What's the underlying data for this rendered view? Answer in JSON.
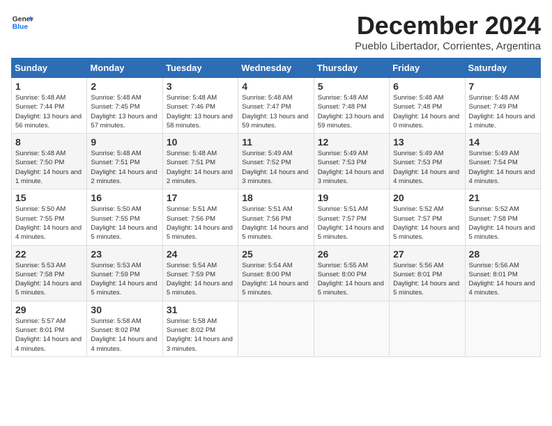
{
  "logo": {
    "line1": "General",
    "line2": "Blue"
  },
  "title": "December 2024",
  "subtitle": "Pueblo Libertador, Corrientes, Argentina",
  "days_of_week": [
    "Sunday",
    "Monday",
    "Tuesday",
    "Wednesday",
    "Thursday",
    "Friday",
    "Saturday"
  ],
  "weeks": [
    [
      {
        "day": "1",
        "sunrise": "Sunrise: 5:48 AM",
        "sunset": "Sunset: 7:44 PM",
        "daylight": "Daylight: 13 hours and 56 minutes."
      },
      {
        "day": "2",
        "sunrise": "Sunrise: 5:48 AM",
        "sunset": "Sunset: 7:45 PM",
        "daylight": "Daylight: 13 hours and 57 minutes."
      },
      {
        "day": "3",
        "sunrise": "Sunrise: 5:48 AM",
        "sunset": "Sunset: 7:46 PM",
        "daylight": "Daylight: 13 hours and 58 minutes."
      },
      {
        "day": "4",
        "sunrise": "Sunrise: 5:48 AM",
        "sunset": "Sunset: 7:47 PM",
        "daylight": "Daylight: 13 hours and 59 minutes."
      },
      {
        "day": "5",
        "sunrise": "Sunrise: 5:48 AM",
        "sunset": "Sunset: 7:48 PM",
        "daylight": "Daylight: 13 hours and 59 minutes."
      },
      {
        "day": "6",
        "sunrise": "Sunrise: 5:48 AM",
        "sunset": "Sunset: 7:48 PM",
        "daylight": "Daylight: 14 hours and 0 minutes."
      },
      {
        "day": "7",
        "sunrise": "Sunrise: 5:48 AM",
        "sunset": "Sunset: 7:49 PM",
        "daylight": "Daylight: 14 hours and 1 minute."
      }
    ],
    [
      {
        "day": "8",
        "sunrise": "Sunrise: 5:48 AM",
        "sunset": "Sunset: 7:50 PM",
        "daylight": "Daylight: 14 hours and 1 minute."
      },
      {
        "day": "9",
        "sunrise": "Sunrise: 5:48 AM",
        "sunset": "Sunset: 7:51 PM",
        "daylight": "Daylight: 14 hours and 2 minutes."
      },
      {
        "day": "10",
        "sunrise": "Sunrise: 5:48 AM",
        "sunset": "Sunset: 7:51 PM",
        "daylight": "Daylight: 14 hours and 2 minutes."
      },
      {
        "day": "11",
        "sunrise": "Sunrise: 5:49 AM",
        "sunset": "Sunset: 7:52 PM",
        "daylight": "Daylight: 14 hours and 3 minutes."
      },
      {
        "day": "12",
        "sunrise": "Sunrise: 5:49 AM",
        "sunset": "Sunset: 7:53 PM",
        "daylight": "Daylight: 14 hours and 3 minutes."
      },
      {
        "day": "13",
        "sunrise": "Sunrise: 5:49 AM",
        "sunset": "Sunset: 7:53 PM",
        "daylight": "Daylight: 14 hours and 4 minutes."
      },
      {
        "day": "14",
        "sunrise": "Sunrise: 5:49 AM",
        "sunset": "Sunset: 7:54 PM",
        "daylight": "Daylight: 14 hours and 4 minutes."
      }
    ],
    [
      {
        "day": "15",
        "sunrise": "Sunrise: 5:50 AM",
        "sunset": "Sunset: 7:55 PM",
        "daylight": "Daylight: 14 hours and 4 minutes."
      },
      {
        "day": "16",
        "sunrise": "Sunrise: 5:50 AM",
        "sunset": "Sunset: 7:55 PM",
        "daylight": "Daylight: 14 hours and 5 minutes."
      },
      {
        "day": "17",
        "sunrise": "Sunrise: 5:51 AM",
        "sunset": "Sunset: 7:56 PM",
        "daylight": "Daylight: 14 hours and 5 minutes."
      },
      {
        "day": "18",
        "sunrise": "Sunrise: 5:51 AM",
        "sunset": "Sunset: 7:56 PM",
        "daylight": "Daylight: 14 hours and 5 minutes."
      },
      {
        "day": "19",
        "sunrise": "Sunrise: 5:51 AM",
        "sunset": "Sunset: 7:57 PM",
        "daylight": "Daylight: 14 hours and 5 minutes."
      },
      {
        "day": "20",
        "sunrise": "Sunrise: 5:52 AM",
        "sunset": "Sunset: 7:57 PM",
        "daylight": "Daylight: 14 hours and 5 minutes."
      },
      {
        "day": "21",
        "sunrise": "Sunrise: 5:52 AM",
        "sunset": "Sunset: 7:58 PM",
        "daylight": "Daylight: 14 hours and 5 minutes."
      }
    ],
    [
      {
        "day": "22",
        "sunrise": "Sunrise: 5:53 AM",
        "sunset": "Sunset: 7:58 PM",
        "daylight": "Daylight: 14 hours and 5 minutes."
      },
      {
        "day": "23",
        "sunrise": "Sunrise: 5:53 AM",
        "sunset": "Sunset: 7:59 PM",
        "daylight": "Daylight: 14 hours and 5 minutes."
      },
      {
        "day": "24",
        "sunrise": "Sunrise: 5:54 AM",
        "sunset": "Sunset: 7:59 PM",
        "daylight": "Daylight: 14 hours and 5 minutes."
      },
      {
        "day": "25",
        "sunrise": "Sunrise: 5:54 AM",
        "sunset": "Sunset: 8:00 PM",
        "daylight": "Daylight: 14 hours and 5 minutes."
      },
      {
        "day": "26",
        "sunrise": "Sunrise: 5:55 AM",
        "sunset": "Sunset: 8:00 PM",
        "daylight": "Daylight: 14 hours and 5 minutes."
      },
      {
        "day": "27",
        "sunrise": "Sunrise: 5:56 AM",
        "sunset": "Sunset: 8:01 PM",
        "daylight": "Daylight: 14 hours and 5 minutes."
      },
      {
        "day": "28",
        "sunrise": "Sunrise: 5:56 AM",
        "sunset": "Sunset: 8:01 PM",
        "daylight": "Daylight: 14 hours and 4 minutes."
      }
    ],
    [
      {
        "day": "29",
        "sunrise": "Sunrise: 5:57 AM",
        "sunset": "Sunset: 8:01 PM",
        "daylight": "Daylight: 14 hours and 4 minutes."
      },
      {
        "day": "30",
        "sunrise": "Sunrise: 5:58 AM",
        "sunset": "Sunset: 8:02 PM",
        "daylight": "Daylight: 14 hours and 4 minutes."
      },
      {
        "day": "31",
        "sunrise": "Sunrise: 5:58 AM",
        "sunset": "Sunset: 8:02 PM",
        "daylight": "Daylight: 14 hours and 3 minutes."
      },
      null,
      null,
      null,
      null
    ]
  ]
}
